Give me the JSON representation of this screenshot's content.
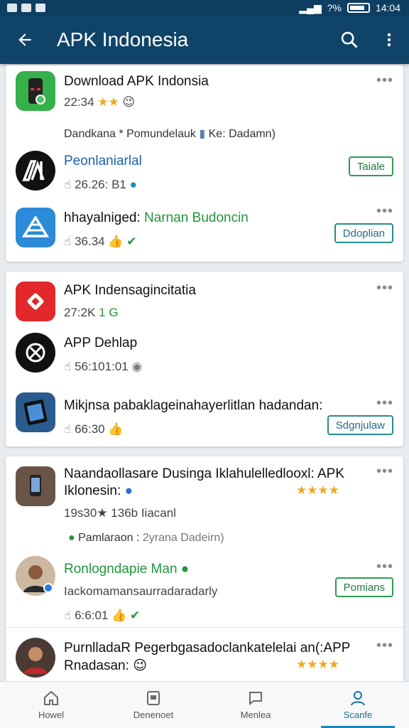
{
  "status": {
    "battery": "?%",
    "time": "14:04"
  },
  "appbar": {
    "title": "APK Indonesia",
    "back_icon": "arrow-left-icon",
    "search_icon": "search-icon",
    "more_icon": "more-vert-icon"
  },
  "card1": {
    "row1": {
      "title": "Download APK Indonsia",
      "meta": "22:34",
      "icon": "phone-icon"
    },
    "row2": {
      "text": "Dandkana * Pomundelauk",
      "text_b": "Ke: Dadamn)"
    },
    "row3": {
      "title": "Peonlaniarlal",
      "meta": "26.26: B1",
      "button": "Taiale"
    },
    "row4": {
      "title_a": "hhayalniged:",
      "title_b": "Narnan Budoncin",
      "meta": "36.34",
      "button": "Ddoplian"
    }
  },
  "card2": {
    "row1": {
      "title": "APK Indensagincitatia",
      "meta_a": "2K",
      "meta_b": "1 G"
    },
    "row2": {
      "title": "APP Dehlap",
      "meta": "56:101:01"
    },
    "row3": {
      "title": "Mikjnsa pabaklageinahayerlitlan hadandan:",
      "meta": "66:30",
      "button": "Sdgnjulaw"
    }
  },
  "card3": {
    "row1": {
      "title_a": "Naandaollasare Dusinga Iklahulelledlooxl: APK",
      "title_b": "Iklonesin:",
      "meta": "19s30★ 136b Iiacanl"
    },
    "row2": {
      "text_a": "Pamlaraon :",
      "text_b": "2yrana Dadeirn)"
    },
    "row3": {
      "title": "Ronlogndapie Man",
      "sub": "Iackomamansaurradaradarly",
      "meta": "6:6:01",
      "button": "Pomians"
    },
    "row4": {
      "title_a": "PurnlladaR Pegerbgasadoclankatelelai an(:APP",
      "title_b": "Rnadasan:"
    }
  },
  "nav": [
    {
      "label": "Howel",
      "icon": "home-icon"
    },
    {
      "label": "Denenoet",
      "icon": "download-icon"
    },
    {
      "label": "Menlea",
      "icon": "chat-icon"
    },
    {
      "label": "Scanfe",
      "icon": "profile-icon"
    }
  ]
}
